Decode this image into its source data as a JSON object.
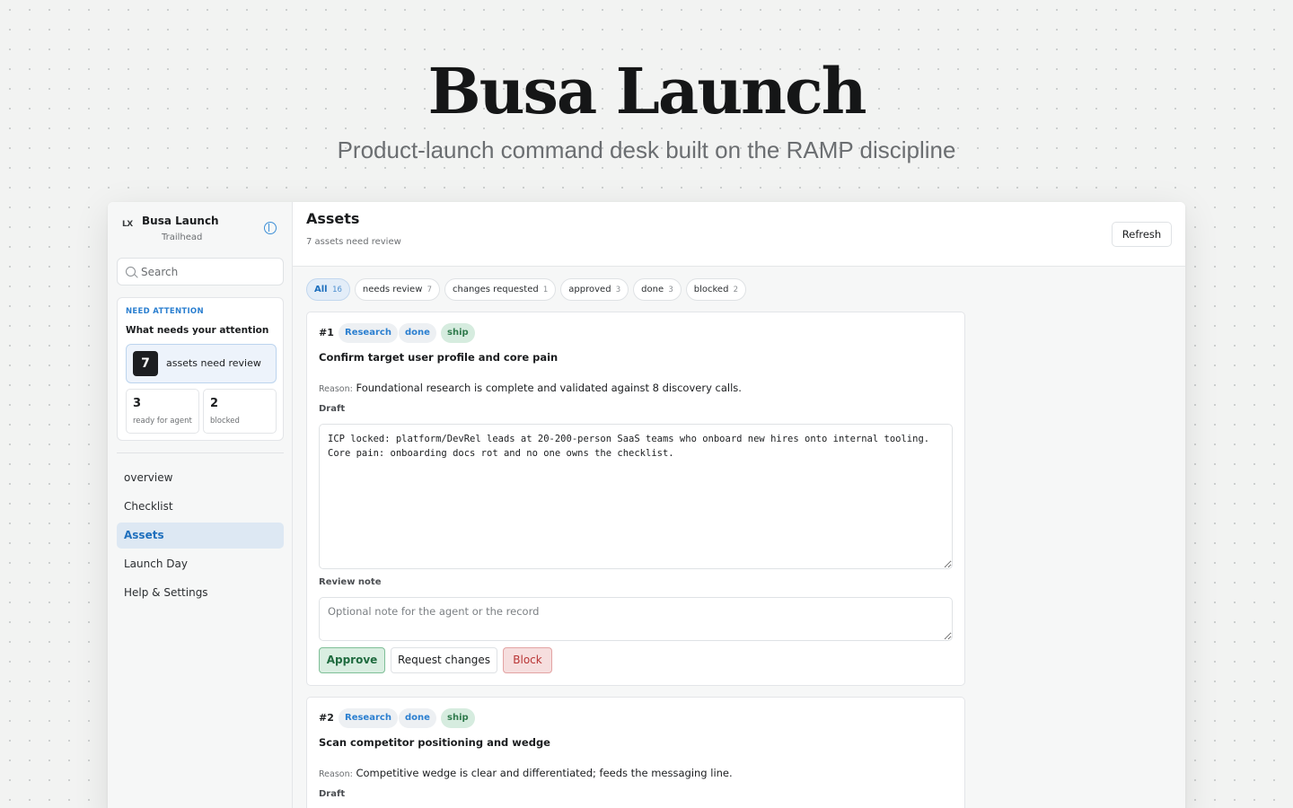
{
  "hero": {
    "title": "Busa Launch",
    "subtitle": "Product-launch command desk built on the RAMP discipline"
  },
  "sidebar": {
    "logo_text": "LX",
    "app_name": "Busa Launch",
    "workspace": "Trailhead",
    "search_placeholder": "Search",
    "attention": {
      "label": "NEED ATTENTION",
      "title": "What needs your attention",
      "review_count": "7",
      "review_text": "assets need review",
      "ready_count": "3",
      "ready_label": "ready for agent",
      "blocked_count": "2",
      "blocked_label": "blocked"
    },
    "nav": [
      {
        "label": "overview",
        "active": false
      },
      {
        "label": "Checklist",
        "active": false
      },
      {
        "label": "Assets",
        "active": true
      },
      {
        "label": "Launch Day",
        "active": false
      },
      {
        "label": "Help & Settings",
        "active": false
      }
    ]
  },
  "main": {
    "title": "Assets",
    "subtitle": "7 assets need review",
    "refresh_label": "Refresh",
    "filters": [
      {
        "label": "All",
        "count": "16",
        "active": true
      },
      {
        "label": "needs review",
        "count": "7",
        "active": false
      },
      {
        "label": "changes requested",
        "count": "1",
        "active": false
      },
      {
        "label": "approved",
        "count": "3",
        "active": false
      },
      {
        "label": "done",
        "count": "3",
        "active": false
      },
      {
        "label": "blocked",
        "count": "2",
        "active": false
      }
    ],
    "cards": [
      {
        "number": "#1",
        "tags": [
          "Research",
          "done",
          "ship"
        ],
        "title": "Confirm target user profile and core pain",
        "reason_label": "Reason:",
        "reason": "Foundational research is complete and validated against 8 discovery calls.",
        "draft_label": "Draft",
        "draft": "ICP locked: platform/DevRel leads at 20-200-person SaaS teams who onboard new hires onto internal tooling. Core pain: onboarding docs rot and no one owns the checklist.",
        "review_label": "Review note",
        "review_placeholder": "Optional note for the agent or the record",
        "approve_label": "Approve",
        "changes_label": "Request changes",
        "block_label": "Block"
      },
      {
        "number": "#2",
        "tags": [
          "Research",
          "done",
          "ship"
        ],
        "title": "Scan competitor positioning and wedge",
        "reason_label": "Reason:",
        "reason": "Competitive wedge is clear and differentiated; feeds the messaging line.",
        "draft_label": "Draft"
      }
    ]
  }
}
